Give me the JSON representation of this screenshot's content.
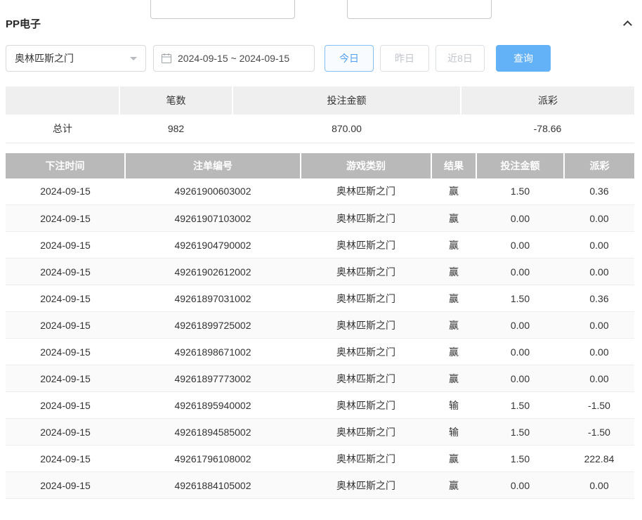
{
  "page": {
    "title": "PP电子"
  },
  "filters": {
    "game_select": {
      "value": "奥林匹斯之门"
    },
    "date_range": {
      "value": "2024-09-15 ~ 2024-09-15"
    },
    "quick_ranges": [
      {
        "label": "今日",
        "active": true
      },
      {
        "label": "昨日",
        "active": false
      },
      {
        "label": "近8日",
        "active": false
      }
    ],
    "search_button": "查询"
  },
  "summary": {
    "headers": [
      "",
      "笔数",
      "投注金额",
      "派彩"
    ],
    "total": {
      "label": "总计",
      "count": "982",
      "bet_amount": "870.00",
      "payout": "-78.66"
    }
  },
  "bets_table": {
    "headers": [
      "下注时间",
      "注单编号",
      "游戏类别",
      "结果",
      "投注金额",
      "派彩"
    ],
    "rows": [
      {
        "time": "2024-09-15",
        "order_no": "49261900603002",
        "game": "奥林匹斯之门",
        "result": "赢",
        "bet": "1.50",
        "payout": "0.36"
      },
      {
        "time": "2024-09-15",
        "order_no": "49261907103002",
        "game": "奥林匹斯之门",
        "result": "赢",
        "bet": "0.00",
        "payout": "0.00"
      },
      {
        "time": "2024-09-15",
        "order_no": "49261904790002",
        "game": "奥林匹斯之门",
        "result": "赢",
        "bet": "0.00",
        "payout": "0.00"
      },
      {
        "time": "2024-09-15",
        "order_no": "49261902612002",
        "game": "奥林匹斯之门",
        "result": "赢",
        "bet": "0.00",
        "payout": "0.00"
      },
      {
        "time": "2024-09-15",
        "order_no": "49261897031002",
        "game": "奥林匹斯之门",
        "result": "赢",
        "bet": "1.50",
        "payout": "0.36"
      },
      {
        "time": "2024-09-15",
        "order_no": "49261899725002",
        "game": "奥林匹斯之门",
        "result": "赢",
        "bet": "0.00",
        "payout": "0.00"
      },
      {
        "time": "2024-09-15",
        "order_no": "49261898671002",
        "game": "奥林匹斯之门",
        "result": "赢",
        "bet": "0.00",
        "payout": "0.00"
      },
      {
        "time": "2024-09-15",
        "order_no": "49261897773002",
        "game": "奥林匹斯之门",
        "result": "赢",
        "bet": "0.00",
        "payout": "0.00"
      },
      {
        "time": "2024-09-15",
        "order_no": "49261895940002",
        "game": "奥林匹斯之门",
        "result": "输",
        "bet": "1.50",
        "payout": "-1.50"
      },
      {
        "time": "2024-09-15",
        "order_no": "49261894585002",
        "game": "奥林匹斯之门",
        "result": "输",
        "bet": "1.50",
        "payout": "-1.50"
      },
      {
        "time": "2024-09-15",
        "order_no": "49261796108002",
        "game": "奥林匹斯之门",
        "result": "赢",
        "bet": "1.50",
        "payout": "222.84"
      },
      {
        "time": "2024-09-15",
        "order_no": "49261884105002",
        "game": "奥林匹斯之门",
        "result": "赢",
        "bet": "0.00",
        "payout": "0.00"
      }
    ]
  },
  "colors": {
    "accent_blue": "#63b1f6",
    "negative_red": "#f56c6c",
    "table_header_gray": "#b9b9b9"
  }
}
